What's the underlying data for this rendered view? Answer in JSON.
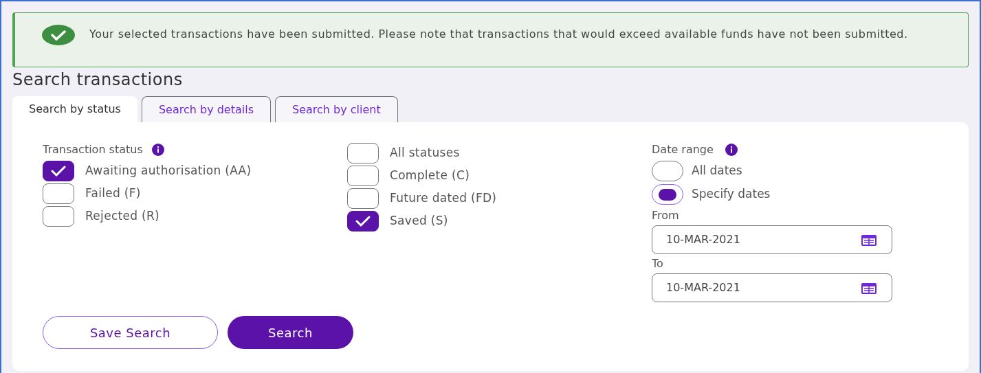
{
  "alert": {
    "text": "Your selected transactions have been submitted. Please note that transactions that would exceed available funds have not been submitted."
  },
  "title": "Search transactions",
  "tabs": [
    {
      "label": "Search by status",
      "selected": true
    },
    {
      "label": "Search by details",
      "selected": false
    },
    {
      "label": "Search by client",
      "selected": false
    }
  ],
  "status": {
    "label": "Transaction status",
    "column_1": [
      {
        "label": "Awaiting authorisation (AA)",
        "checked": true
      },
      {
        "label": "Failed (F)",
        "checked": false
      },
      {
        "label": "Rejected (R)",
        "checked": false
      }
    ],
    "column_2": [
      {
        "label": "All statuses",
        "checked": false
      },
      {
        "label": "Complete (C)",
        "checked": false
      },
      {
        "label": "Future dated (FD)",
        "checked": false
      },
      {
        "label": "Saved (S)",
        "checked": true
      }
    ]
  },
  "date_range": {
    "label": "Date range",
    "options": [
      {
        "label": "All dates",
        "selected": false
      },
      {
        "label": "Specify dates",
        "selected": true
      }
    ],
    "fields": [
      {
        "label": "From",
        "value": "10-MAR-2021"
      },
      {
        "label": "To",
        "value": "10-MAR-2021"
      }
    ]
  },
  "buttons": [
    {
      "label": "Save Search",
      "kind": "secondary"
    },
    {
      "label": "Search",
      "kind": "primary"
    }
  ]
}
